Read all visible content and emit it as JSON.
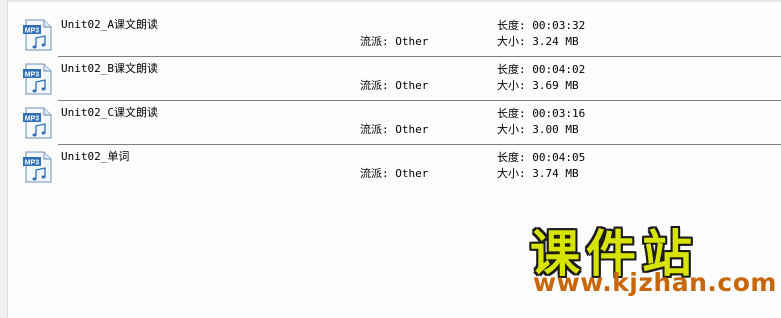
{
  "files": [
    {
      "name": "Unit02_A课文朗读",
      "genre": "流派: Other",
      "length": "长度: 00:03:32",
      "size": "大小: 3.24 MB",
      "icon": "mp3-file-icon",
      "icon_label": "MP3"
    },
    {
      "name": "Unit02_B课文朗读",
      "genre": "流派: Other",
      "length": "长度: 00:04:02",
      "size": "大小: 3.69 MB",
      "icon": "mp3-file-icon",
      "icon_label": "MP3"
    },
    {
      "name": "Unit02_C课文朗读",
      "genre": "流派: Other",
      "length": "长度: 00:03:16",
      "size": "大小: 3.00 MB",
      "icon": "mp3-file-icon",
      "icon_label": "MP3"
    },
    {
      "name": "Unit02_单词",
      "genre": "流派: Other",
      "length": "长度: 00:04:05",
      "size": "大小: 3.74 MB",
      "icon": "mp3-file-icon",
      "icon_label": "MP3"
    }
  ],
  "watermark": {
    "title": "课件站",
    "url": "www.kjzhan.com"
  },
  "colors": {
    "watermark_title": "#d6e400",
    "watermark_url": "#c8660a",
    "icon_blue": "#2f6fb5"
  }
}
